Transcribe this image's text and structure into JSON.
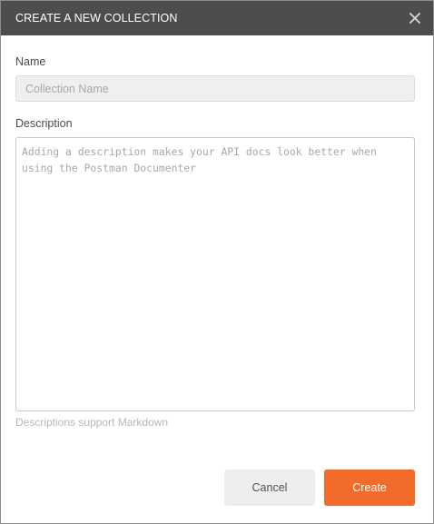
{
  "header": {
    "title": "CREATE A NEW COLLECTION"
  },
  "form": {
    "name_label": "Name",
    "name_placeholder": "Collection Name",
    "name_value": "",
    "description_label": "Description",
    "description_placeholder": "Adding a description makes your API docs look better when using the Postman Documenter",
    "description_value": "",
    "description_hint": "Descriptions support Markdown"
  },
  "footer": {
    "cancel_label": "Cancel",
    "create_label": "Create"
  },
  "colors": {
    "header_bg": "#4d4d4d",
    "accent": "#f26b2a"
  },
  "icons": {
    "close": "close-icon"
  }
}
